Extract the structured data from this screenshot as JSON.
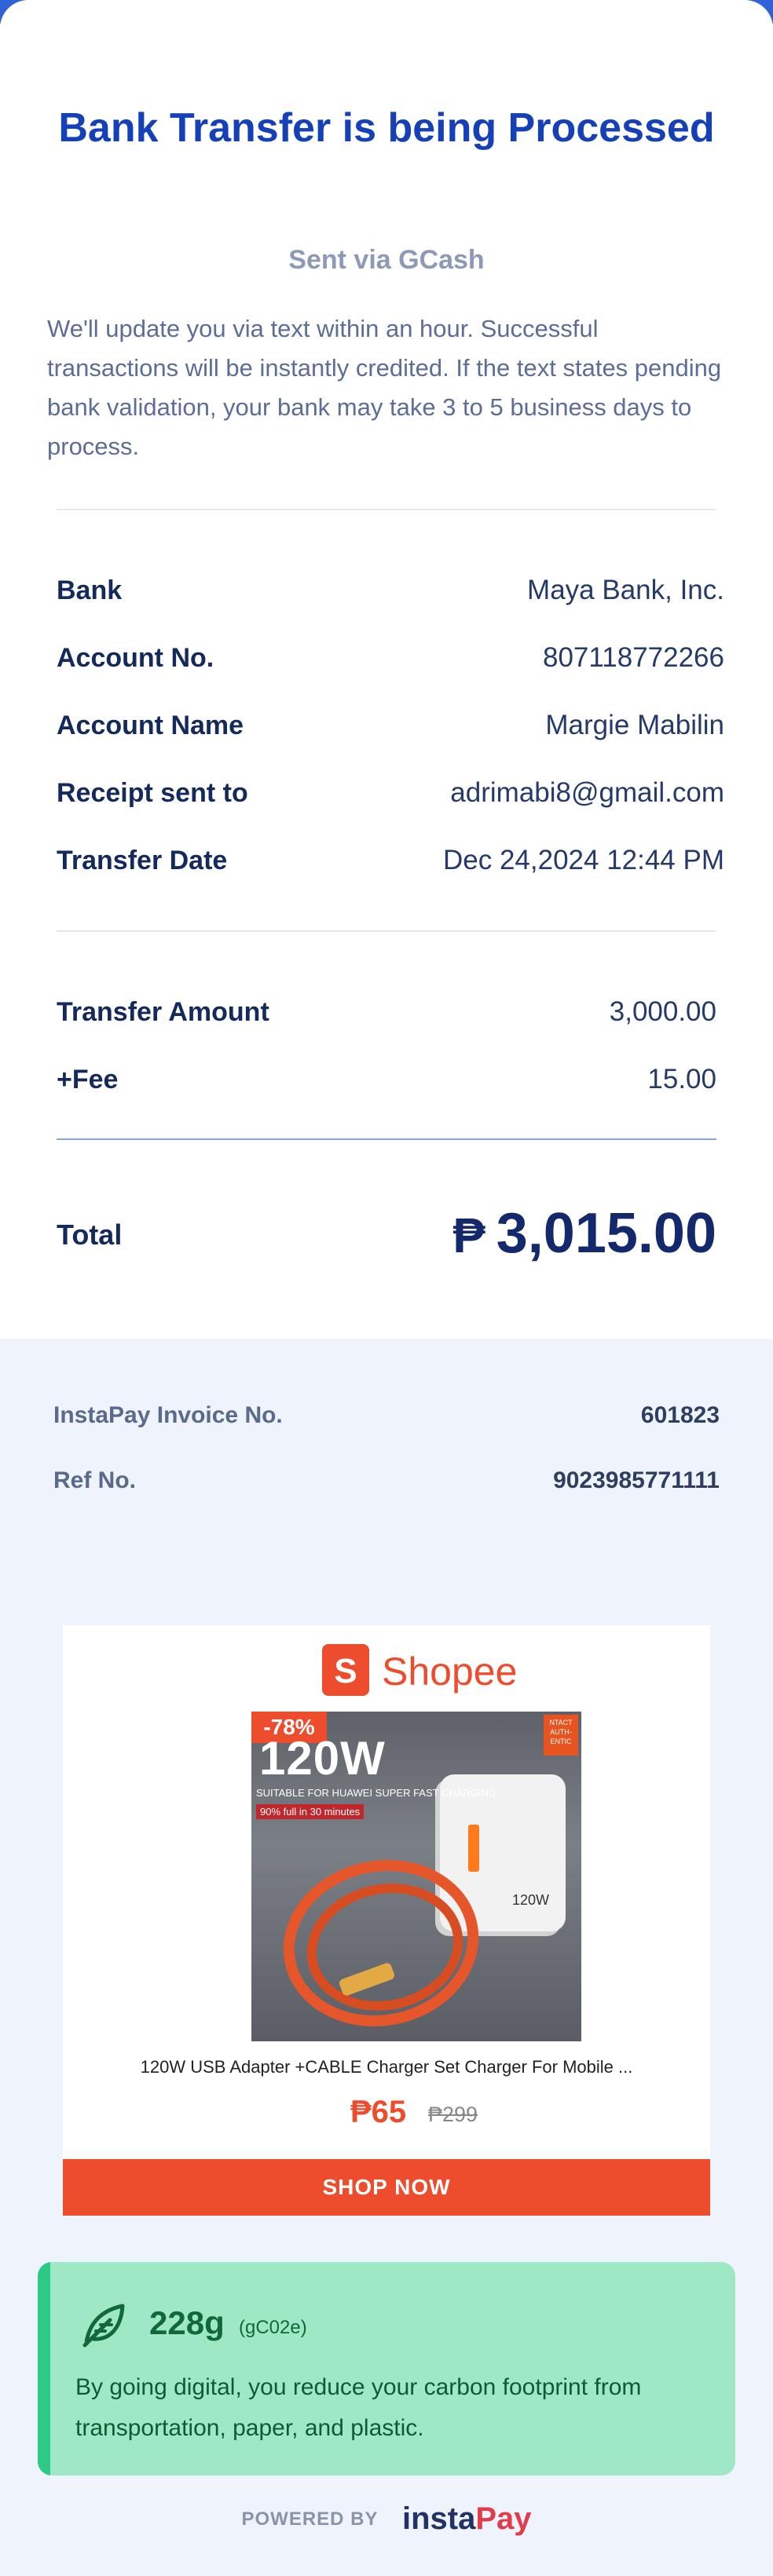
{
  "header": {
    "title": "Bank Transfer is being Processed",
    "subtitle": "Sent via GCash",
    "description": "We'll update you via text within an hour. Successful transactions will be instantly credited. If the text states pending bank validation, your bank may take 3 to 5 business days to process."
  },
  "details": [
    {
      "label": "Bank",
      "value": "Maya Bank, Inc."
    },
    {
      "label": "Account No.",
      "value": "807118772266"
    },
    {
      "label": "Account Name",
      "value": "Margie Mabilin"
    },
    {
      "label": "Receipt sent to",
      "value": "adrimabi8@gmail.com"
    },
    {
      "label": "Transfer Date",
      "value": "Dec 24,2024 12:44 PM"
    }
  ],
  "amounts": [
    {
      "label": "Transfer Amount",
      "value": "3,000.00"
    },
    {
      "label": "+Fee",
      "value": "15.00"
    }
  ],
  "total": {
    "label": "Total",
    "currency": "₱",
    "value": "3,015.00"
  },
  "invoice": [
    {
      "label": "InstaPay Invoice No.",
      "value": "601823"
    },
    {
      "label": "Ref No.",
      "value": "9023985771111"
    }
  ],
  "ad": {
    "brand": "Shopee",
    "brand_initial": "S",
    "discount": "-78%",
    "image_headline": "120W",
    "image_subline": "SUITABLE FOR HUAWEI SUPER FAST CHARGING",
    "image_badge": "90% full in 30 minutes",
    "image_corner": "NTACT AUTH- ENTIC",
    "image_charger_label": "120W",
    "product_name": "120W USB Adapter +CABLE Charger Set Charger For Mobile ...",
    "price": "₱65",
    "original_price": "₱299",
    "cta": "SHOP NOW",
    "brand_color": "#ee4d2d"
  },
  "eco": {
    "amount": "228g",
    "unit": "(gC02e)",
    "text": "By going digital, you reduce your carbon footprint from transportation, paper, and plastic.",
    "icon": "leaf-icon"
  },
  "footer": {
    "powered_by": "POWERED BY",
    "brand_part1": "insta",
    "brand_part2": "Pay"
  }
}
